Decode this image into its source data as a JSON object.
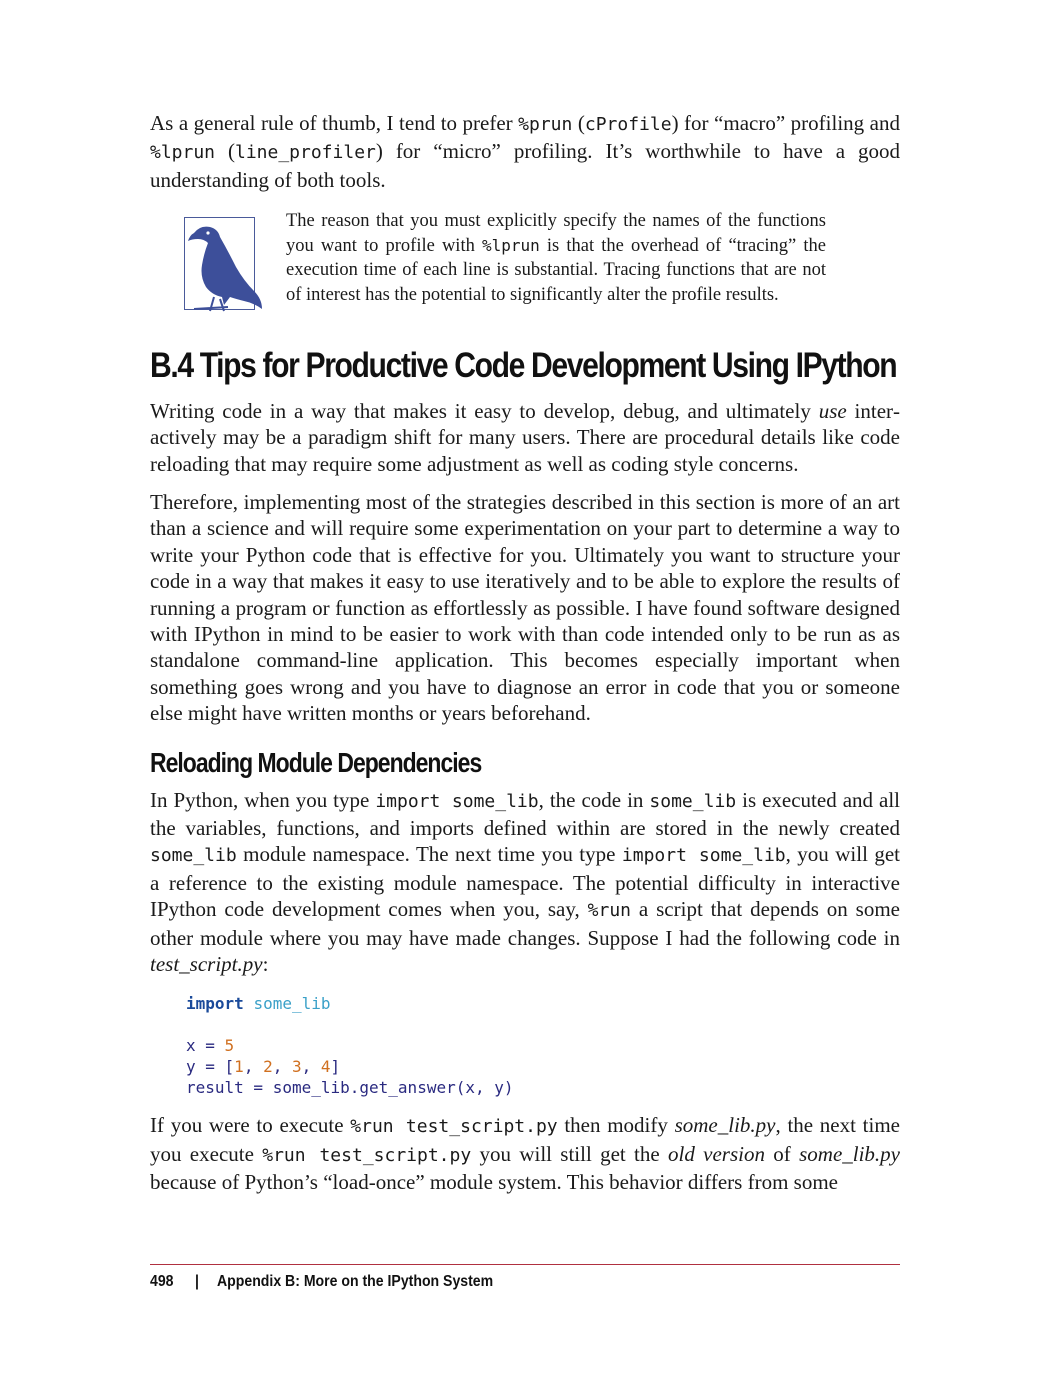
{
  "intro": {
    "t1": "As a general rule of thumb, I tend to prefer ",
    "c1": "%prun",
    "t2": " (",
    "c2": "cProfile",
    "t3": ") for “macro” profiling and ",
    "c3": "%lprun",
    "t4": " (",
    "c4": "line_profiler",
    "t5": ") for “micro” profiling. It’s worthwhile to have a good understanding of both tools."
  },
  "note": {
    "t1": "The reason that you must explicitly specify the names of the func­tions you want to profile with ",
    "c1": "%lprun",
    "t2": " is that the overhead of “trac­ing” the execution time of each line is substantial. Tracing functions that are not of interest has the potential to significantly alter the profile results.",
    "icon": "crow-icon"
  },
  "section_title": "B.4 Tips for Productive Code Development Using IPython",
  "para1": {
    "t1": "Writing code in a way that makes it easy to develop, debug, and ultimately ",
    "em1": "use",
    "t2": " inter­actively may be a paradigm shift for many users. There are procedural details like code reloading that may require some adjustment as well as coding style concerns."
  },
  "para2": "Therefore, implementing most of the strategies described in this section is more of an art than a science and will require some experimentation on your part to determine a way to write your Python code that is effective for you. Ultimately you want to struc­ture your code in a way that makes it easy to use iteratively and to be able to explore the results of running a program or function as effortlessly as possible. I have found software designed with IPython in mind to be easier to work with than code intended only to be run as as standalone command-line application. This becomes especially important when something goes wrong and you have to diagnose an error in code that you or someone else might have written months or years beforehand.",
  "subsection_title": "Reloading Module Dependencies",
  "para3": {
    "t1": "In Python, when you type ",
    "c1": "import some_lib",
    "t2": ", the code in ",
    "c2": "some_lib",
    "t3": " is executed and all the variables, functions, and imports defined within are stored in the newly created ",
    "c3": "some_lib",
    "t4": " module namespace. The next time you type ",
    "c4": "import some_lib",
    "t5": ", you will get a reference to the existing module namespace. The potential difficulty in interactive IPython code development comes when you, say, ",
    "c5": "%run",
    "t6": " a script that depends on some other module where you may have made changes. Suppose I had the following code in ",
    "em1": "test_script.py",
    "t7": ":"
  },
  "code": {
    "l1_kw": "import",
    "l1_mod": "some_lib",
    "l3_a": "x = ",
    "l3_n": "5",
    "l4_a": "y = [",
    "l4_n1": "1",
    "l4_n2": "2",
    "l4_n3": "3",
    "l4_n4": "4",
    "l4_b": "]",
    "l5": "result = some_lib.get_answer(x, y)"
  },
  "para4": {
    "t1": "If you were to execute ",
    "c1": "%run test_script.py",
    "t2": " then modify ",
    "em1": "some_lib.py",
    "t3": ", the next time you execute ",
    "c2": "%run test_script.py",
    "t4": " you will still get the ",
    "em2": "old version",
    "t5": " of ",
    "em3": "some_lib.py",
    "t6": " because of Python’s “load-once” module system. This behavior differs from some"
  },
  "footer": {
    "page_number": "498",
    "separator": "|",
    "chapter": "Appendix B: More on the IPython System"
  }
}
